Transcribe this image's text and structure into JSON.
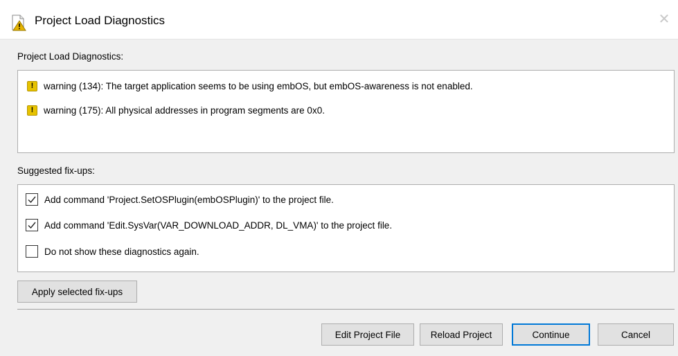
{
  "window": {
    "title": "Project Load Diagnostics",
    "close_glyph": "✕",
    "icon": "document-warning-icon"
  },
  "diagnostics": {
    "label": "Project Load Diagnostics:",
    "items": [
      {
        "icon": "warning-icon",
        "glyph": "!",
        "text": "warning (134): The target application seems to be using embOS, but embOS-awareness is not enabled."
      },
      {
        "icon": "warning-icon",
        "glyph": "!",
        "text": "warning (175): All physical addresses in program segments are 0x0."
      }
    ]
  },
  "fixups": {
    "label": "Suggested fix-ups:",
    "items": [
      {
        "checked": true,
        "text": "Add command 'Project.SetOSPlugin(embOSPlugin)' to the project file."
      },
      {
        "checked": true,
        "text": "Add command 'Edit.SysVar(VAR_DOWNLOAD_ADDR, DL_VMA)' to the project file."
      },
      {
        "checked": false,
        "text": "Do not show these diagnostics again."
      }
    ],
    "apply_label": "Apply selected fix-ups"
  },
  "buttons": {
    "edit_project_file": "Edit Project File",
    "reload_project": "Reload Project",
    "continue": "Continue",
    "cancel": "Cancel"
  },
  "colors": {
    "warning": "#e6c200",
    "default_button_border": "#0078d7"
  }
}
